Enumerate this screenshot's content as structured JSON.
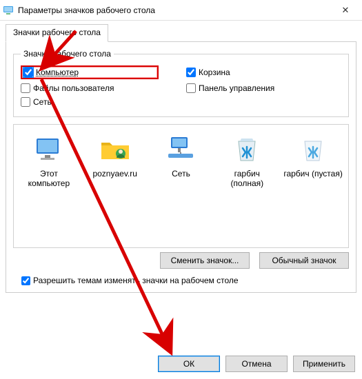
{
  "window": {
    "title": "Параметры значков рабочего стола",
    "close_icon": "✕"
  },
  "tab_label": "Значки рабочего стола",
  "group_legend": "Значки рабочего стола",
  "checks": {
    "computer": "Компьютер",
    "recycle": "Корзина",
    "userfiles": "Файлы пользователя",
    "control": "Панель управления",
    "network": "Сеть"
  },
  "preview": {
    "items": [
      {
        "label": "Этот компьютер"
      },
      {
        "label": "poznyaev.ru"
      },
      {
        "label": "Сеть"
      },
      {
        "label": "гарбич (полная)"
      },
      {
        "label": "гарбич (пустая)"
      }
    ]
  },
  "buttons": {
    "change_icon": "Сменить значок...",
    "default_icon": "Обычный значок",
    "ok": "ОК",
    "cancel": "Отмена",
    "apply": "Применить"
  },
  "allow_themes": "Разрешить темам изменять значки на рабочем столе"
}
